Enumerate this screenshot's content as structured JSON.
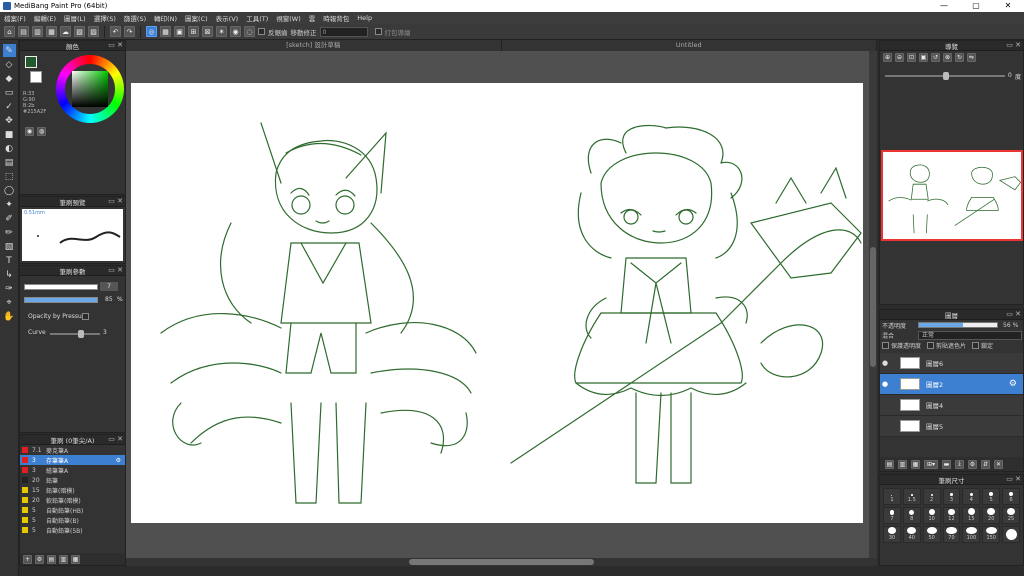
{
  "window": {
    "title": "MediBang Paint Pro (64bit)",
    "controls": [
      "—",
      "▢",
      "✕"
    ]
  },
  "menu": [
    "檔案(F)",
    "編輯(E)",
    "圖層(L)",
    "選擇(S)",
    "篩選(S)",
    "轉印(N)",
    "圖案(C)",
    "表示(V)",
    "工具(T)",
    "視窗(W)",
    "雲",
    "時報背包",
    "Help"
  ],
  "toolbar": {
    "antialias": "反鋸齒",
    "correction_label": "移動修正",
    "correction_value": "0",
    "option_label": "打包導繪"
  },
  "canvas": {
    "tabs": [
      "[sketch] 設計草稿",
      "Untitled"
    ]
  },
  "color_panel": {
    "title": "顏色",
    "values": [
      "R:33",
      "G:90",
      "B:2b",
      "#215A2F"
    ]
  },
  "brush_preview": {
    "title": "筆刷預覽",
    "size": "0.51mm"
  },
  "brush_control": {
    "title": "筆刷參數",
    "size_value": "7",
    "opacity_value": "85",
    "opacity_unit": "%",
    "pressure_label": "Opacity by Pressure",
    "curve_label": "Curve",
    "curve_value": "3"
  },
  "brush_list": {
    "title": "筆刷 (0筆尖/A)",
    "items": [
      {
        "num": "7.1",
        "name": "麥克筆A",
        "color": "#e02020"
      },
      {
        "num": "3",
        "name": "存筆筆A",
        "color": "#e02020",
        "selected": true
      },
      {
        "num": "3",
        "name": "繪筆筆A",
        "color": "#e02020"
      },
      {
        "num": "20",
        "name": "鉛筆",
        "color": "#222222"
      },
      {
        "num": "15",
        "name": "鉛筆(暗模)",
        "color": "#e6c800"
      },
      {
        "num": "20",
        "name": "軟鉛筆(暗模)",
        "color": "#e6c800"
      },
      {
        "num": "5",
        "name": "自動鉛筆(HB)",
        "color": "#e6c800"
      },
      {
        "num": "5",
        "name": "自動鉛筆(B)",
        "color": "#e6c800"
      },
      {
        "num": "5",
        "name": "自動鉛筆(5B)",
        "color": "#e6c800"
      }
    ]
  },
  "navigator": {
    "title": "導覽",
    "zoom_value": "0",
    "zoom_unit": "度"
  },
  "layers": {
    "title": "圖層",
    "opacity_label": "不透明度",
    "opacity_value": "56",
    "opacity_unit": "%",
    "blend_label": "混合",
    "blend_value": "正常",
    "opts": [
      "保護透明度",
      "剪貼遮色片",
      "鎖定"
    ],
    "items": [
      {
        "name": "圖層6",
        "visible": true,
        "selected": false
      },
      {
        "name": "圖層2",
        "visible": true,
        "selected": true
      },
      {
        "name": "圖層4",
        "visible": false,
        "selected": false
      },
      {
        "name": "圖層5",
        "visible": false,
        "selected": false
      }
    ]
  },
  "brush_size": {
    "title": "筆刷尺寸",
    "sizes": [
      "1",
      "1.5",
      "2",
      "3",
      "4",
      "5",
      "6",
      "7",
      "8",
      "10",
      "12",
      "15",
      "20",
      "25",
      "30",
      "40",
      "50",
      "70",
      "100",
      "150",
      ""
    ]
  },
  "colors": {
    "accent": "#3d7fd1",
    "sketch": "#2e6b2e"
  }
}
